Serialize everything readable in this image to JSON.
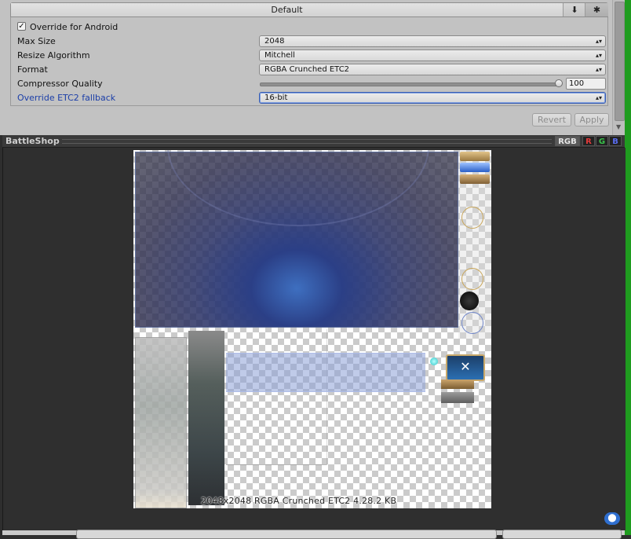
{
  "tabs": {
    "default_label": "Default",
    "standalone_icon": "download-icon",
    "android_icon": "android-icon"
  },
  "settings": {
    "override_label": "Override for Android",
    "override_checked": true,
    "max_size": {
      "label": "Max Size",
      "value": "2048"
    },
    "resize_algorithm": {
      "label": "Resize Algorithm",
      "value": "Mitchell"
    },
    "format": {
      "label": "Format",
      "value": "RGBA Crunched ETC2"
    },
    "compressor_quality": {
      "label": "Compressor Quality",
      "value": "100"
    },
    "etc2_fallback": {
      "label": "Override ETC2 fallback",
      "value": "16-bit"
    }
  },
  "buttons": {
    "revert": "Revert",
    "apply": "Apply"
  },
  "preview": {
    "title": "BattleShop",
    "channels": {
      "rgb": "RGB",
      "r": "R",
      "g": "G",
      "b": "B"
    },
    "info": "2048x2048  RGBA Crunched ETC2   4.28.2 KB"
  },
  "colors": {
    "panel_bg": "#c2c2c2",
    "preview_bg": "#2e2e2e",
    "fallback_label": "#1b3ea8",
    "green_strip": "#1f9c1f"
  }
}
